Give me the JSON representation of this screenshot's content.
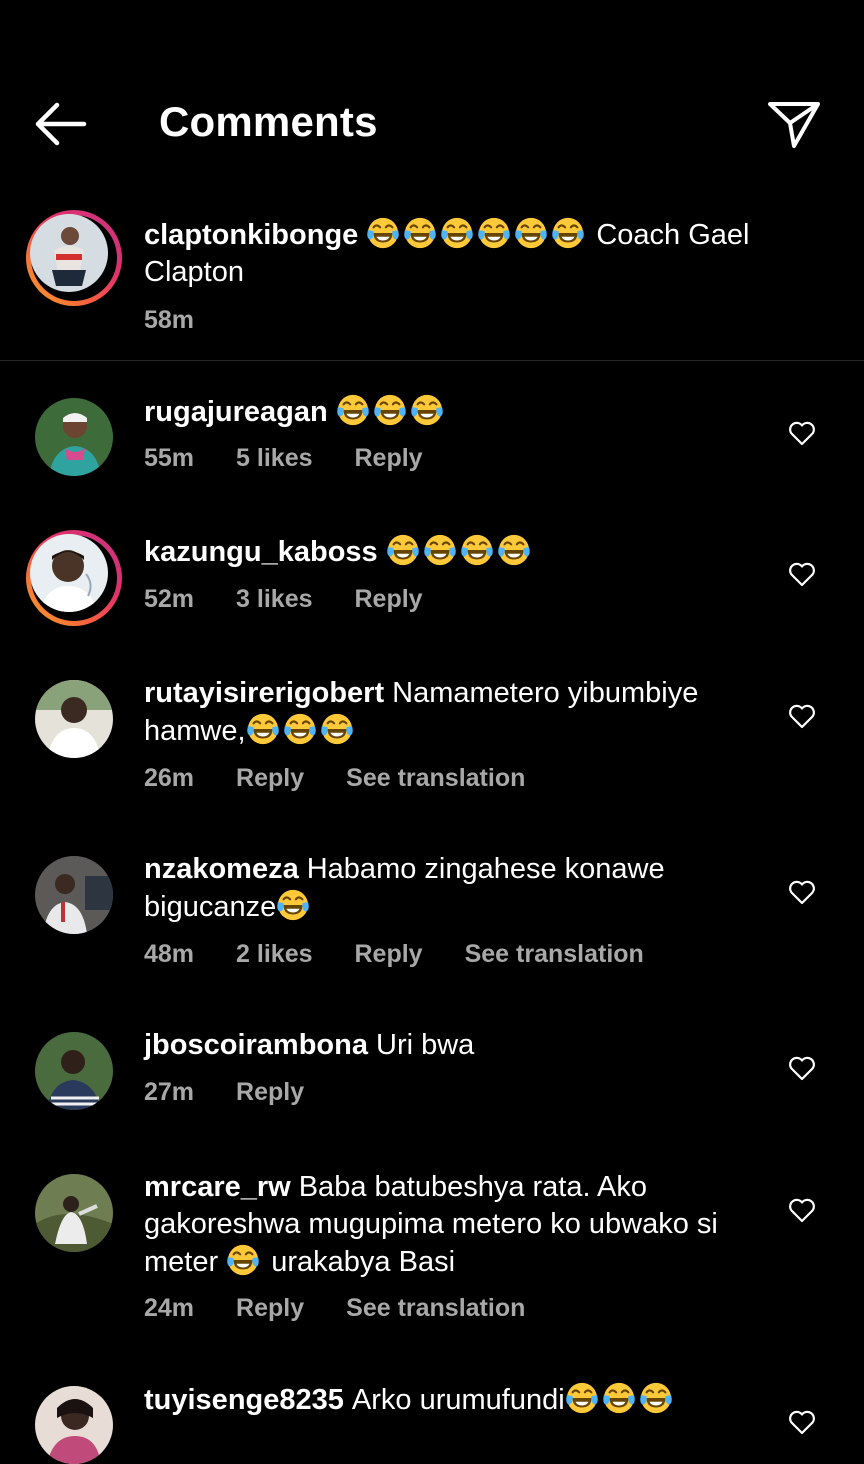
{
  "header": {
    "title": "Comments"
  },
  "caption": {
    "username": "claptonkibonge",
    "emoji_count": 6,
    "text": "Coach Gael Clapton",
    "time": "58m"
  },
  "comments": [
    {
      "username": "rugajureagan",
      "text": "",
      "emoji_count": 3,
      "time": "55m",
      "likes": "5 likes",
      "reply": "Reply",
      "translation": ""
    },
    {
      "username": "kazungu_kaboss",
      "text": "",
      "emoji_count": 4,
      "time": "52m",
      "likes": "3 likes",
      "reply": "Reply",
      "translation": ""
    },
    {
      "username": "rutayisirerigobert",
      "text": "Namametero yibumbiye hamwe,",
      "emoji_count": 3,
      "time": "26m",
      "likes": "",
      "reply": "Reply",
      "translation": "See translation"
    },
    {
      "username": "nzakomeza",
      "text": "Habamo zingahese konawe bigucanze",
      "emoji_count": 1,
      "time": "48m",
      "likes": "2 likes",
      "reply": "Reply",
      "translation": "See translation"
    },
    {
      "username": "jboscoirambona",
      "text": "Uri bwa",
      "emoji_count": 0,
      "time": "27m",
      "likes": "",
      "reply": "Reply",
      "translation": ""
    },
    {
      "username": "mrcare_rw",
      "text_before": "Baba batubeshya rata. Ako gakoreshwa mugupima metero ko ubwako si meter",
      "text_after": "urakabya Basi",
      "time": "24m",
      "likes": "",
      "reply": "Reply",
      "translation": "See translation"
    },
    {
      "username": "tuyisenge8235",
      "text": "Arko urumufundi",
      "emoji_count": 3,
      "time": "",
      "likes": "",
      "reply": "",
      "translation": ""
    }
  ],
  "icons": {
    "back": "arrow-left-icon",
    "send": "paper-plane-icon",
    "like": "heart-outline-icon",
    "emoji": "face-with-tears-of-joy-emoji"
  },
  "colors": {
    "background": "#000000",
    "text": "#ffffff",
    "meta": "#a8a8a8",
    "divider": "#262626",
    "story_ring_start": "#f9a825",
    "story_ring_end": "#c13584",
    "emoji_face": "#ffc93a",
    "emoji_tears": "#4fb3f6"
  }
}
